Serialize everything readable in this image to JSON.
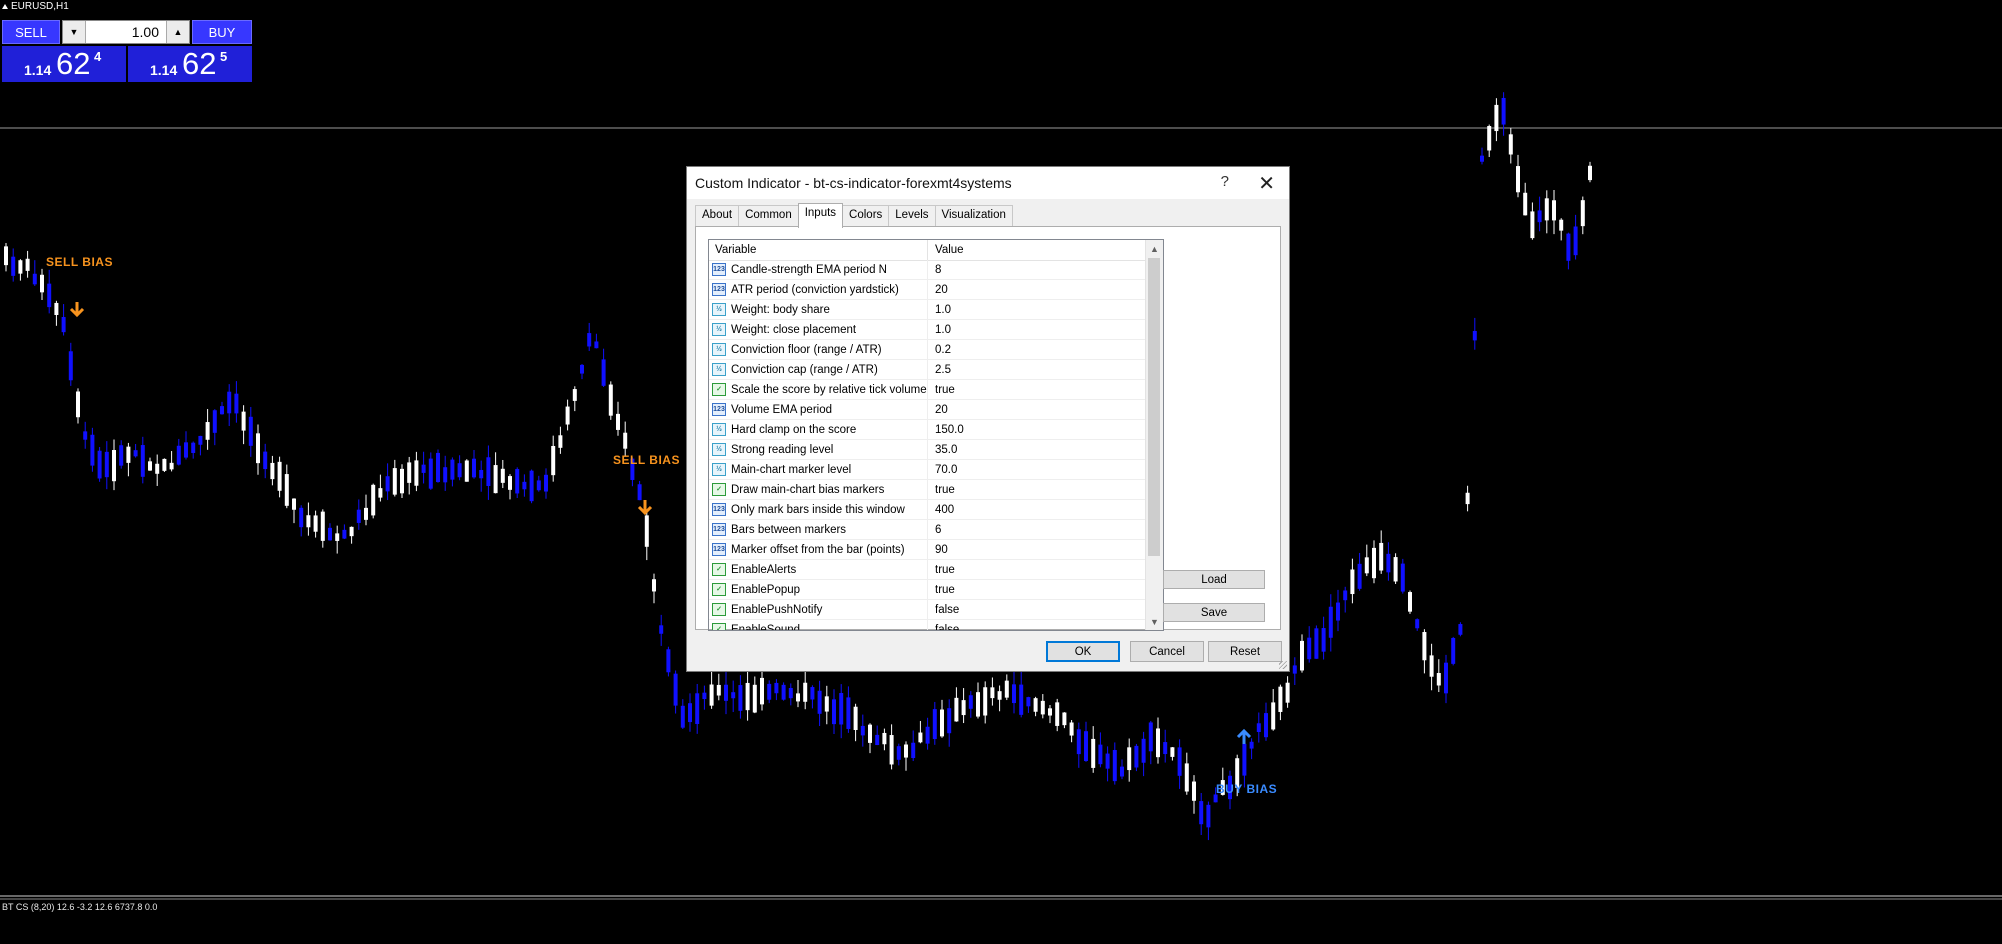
{
  "chart": {
    "symbol": "EURUSD,H1",
    "status_line": "BT CS (8,20) 12.6 -3.2 12.6 6737.8 0.0",
    "markers": [
      {
        "text": "SELL BIAS",
        "type": "sell"
      },
      {
        "text": "SELL BIAS",
        "type": "sell"
      },
      {
        "text": "BUY BIAS",
        "type": "buy"
      }
    ],
    "colors": {
      "background": "#000000",
      "bull_candle": "#ffffff",
      "bear_candle": "#1010ff",
      "sell_marker": "#f7931e",
      "buy_marker": "#3a8bff"
    }
  },
  "trade_panel": {
    "sell_label": "SELL",
    "buy_label": "BUY",
    "lot_value": "1.00",
    "bid": {
      "prefix": "1.14",
      "big": "62",
      "sup": "4"
    },
    "ask": {
      "prefix": "1.14",
      "big": "62",
      "sup": "5"
    }
  },
  "dialog": {
    "title": "Custom Indicator - bt-cs-indicator-forexmt4systems",
    "help_glyph": "?",
    "close_glyph": "✕",
    "tabs": [
      "About",
      "Common",
      "Inputs",
      "Colors",
      "Levels",
      "Visualization"
    ],
    "active_tab": "Inputs",
    "grid": {
      "headers": {
        "variable": "Variable",
        "value": "Value"
      },
      "rows": [
        {
          "icon": "int",
          "name": "Candle-strength EMA period N",
          "value": "8"
        },
        {
          "icon": "int",
          "name": "ATR period (conviction yardstick)",
          "value": "20"
        },
        {
          "icon": "dbl",
          "name": "Weight: body share",
          "value": "1.0"
        },
        {
          "icon": "dbl",
          "name": "Weight: close placement",
          "value": "1.0"
        },
        {
          "icon": "dbl",
          "name": "Conviction floor (range / ATR)",
          "value": "0.2"
        },
        {
          "icon": "dbl",
          "name": "Conviction cap  (range / ATR)",
          "value": "2.5"
        },
        {
          "icon": "bool",
          "name": "Scale the score by relative tick volume",
          "value": "true"
        },
        {
          "icon": "int",
          "name": "Volume EMA period",
          "value": "20"
        },
        {
          "icon": "dbl",
          "name": "Hard clamp on the score",
          "value": "150.0"
        },
        {
          "icon": "dbl",
          "name": "Strong reading level",
          "value": "35.0"
        },
        {
          "icon": "dbl",
          "name": "Main-chart marker level",
          "value": "70.0"
        },
        {
          "icon": "bool",
          "name": "Draw main-chart bias markers",
          "value": "true"
        },
        {
          "icon": "int",
          "name": "Only mark bars inside this window",
          "value": "400"
        },
        {
          "icon": "int",
          "name": "Bars between markers",
          "value": "6"
        },
        {
          "icon": "int",
          "name": "Marker offset from the bar (points)",
          "value": "90"
        },
        {
          "icon": "bool",
          "name": "EnableAlerts",
          "value": "true"
        },
        {
          "icon": "bool",
          "name": "EnablePopup",
          "value": "true"
        },
        {
          "icon": "bool",
          "name": "EnablePushNotify",
          "value": "false"
        },
        {
          "icon": "bool",
          "name": "EnableSound",
          "value": "false"
        }
      ]
    },
    "buttons": {
      "load": "Load",
      "save": "Save",
      "ok": "OK",
      "cancel": "Cancel",
      "reset": "Reset"
    }
  }
}
